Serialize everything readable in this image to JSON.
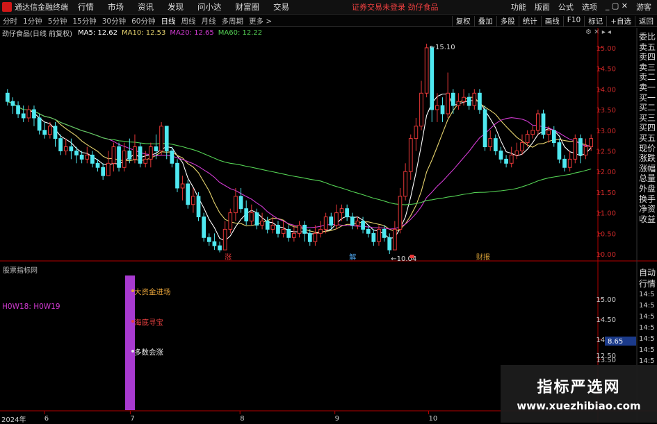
{
  "menubar": {
    "app_title": "通达信金融终端",
    "menus": [
      "行情",
      "市场",
      "资讯",
      "发现",
      "问小达",
      "财富圈",
      "交易"
    ],
    "alert": "证券交易未登录 劲仔食品",
    "right_items": [
      "功能",
      "版面",
      "公式",
      "选项"
    ],
    "window_controls": "_ ▢ ✕",
    "guest": "游客"
  },
  "periodbar": {
    "tabs": [
      "分时",
      "1分钟",
      "5分钟",
      "15分钟",
      "30分钟",
      "60分钟",
      "日线",
      "周线",
      "月线",
      "多周期",
      "更多 >"
    ],
    "active": "日线",
    "right_buttons": [
      "复权",
      "叠加",
      "多股",
      "统计",
      "画线",
      "F10",
      "标记",
      "+自选",
      "返回"
    ]
  },
  "chart_header": {
    "stock": "劲仔食品(日线 前复权)",
    "ma5": "MA5: 12.62",
    "ma10": "MA10: 12.53",
    "ma20": "MA20: 12.65",
    "ma60": "MA60: 12.22",
    "icons": "⚙ ✕ ▸ ◂"
  },
  "right_panel": [
    "委比",
    "卖五",
    "卖四",
    "卖三",
    "卖二",
    "卖一",
    "买一",
    "买二",
    "买三",
    "买四",
    "买五",
    "现价",
    "涨跌",
    "涨幅",
    "总量",
    "外盘",
    "换手",
    "净资",
    "收益"
  ],
  "right_panel_bottom": [
    "自动",
    "行情",
    "14:5",
    "14:5",
    "14:5",
    "14:5",
    "14:5",
    "14:5",
    "14:5"
  ],
  "colors": {
    "up": "#e83838",
    "down": "#4fe8f0",
    "ma5": "#ffffff",
    "ma10": "#e6d36e",
    "ma20": "#d03ad0",
    "ma60": "#54d254",
    "axis": "#b40000",
    "grid": "#3a0000"
  },
  "chart_data": {
    "type": "candlestick",
    "title": "劲仔食品(日线 前复权)",
    "xlabel": "",
    "ylabel": "",
    "ylim": [
      9.9,
      15.2
    ],
    "yticks": [
      "15.00",
      "14.50",
      "14.00",
      "13.50",
      "13.00",
      "12.50",
      "12.00",
      "11.50",
      "11.00",
      "10.50",
      "10.00"
    ],
    "x_month_labels": [
      "2024年",
      "6",
      "7",
      "8",
      "9",
      "10"
    ],
    "annotations": {
      "high": "15.10",
      "low": "10.04"
    },
    "event_markers": [
      "涨",
      "解",
      "",
      "财报"
    ],
    "moving_averages": {
      "MA5": 12.62,
      "MA10": 12.53,
      "MA20": 12.65,
      "MA60": 12.22
    },
    "candles": [
      [
        13.9,
        13.7,
        14.0,
        13.6
      ],
      [
        13.7,
        13.6,
        13.8,
        13.4
      ],
      [
        13.6,
        13.4,
        13.7,
        13.3
      ],
      [
        13.4,
        13.3,
        13.6,
        13.2
      ],
      [
        13.3,
        13.5,
        13.6,
        13.2
      ],
      [
        13.5,
        13.3,
        13.6,
        13.1
      ],
      [
        13.3,
        13.0,
        13.4,
        12.9
      ],
      [
        13.0,
        12.9,
        13.2,
        12.8
      ],
      [
        12.9,
        13.1,
        13.2,
        12.8
      ],
      [
        13.1,
        12.8,
        13.2,
        12.6
      ],
      [
        12.8,
        12.5,
        12.9,
        12.4
      ],
      [
        12.5,
        12.6,
        12.8,
        12.4
      ],
      [
        12.6,
        12.5,
        12.8,
        12.3
      ],
      [
        12.5,
        12.4,
        12.6,
        12.2
      ],
      [
        12.4,
        12.3,
        12.5,
        12.2
      ],
      [
        12.3,
        12.4,
        12.6,
        12.2
      ],
      [
        12.4,
        12.2,
        12.5,
        12.1
      ],
      [
        12.2,
        12.1,
        12.3,
        12.0
      ],
      [
        12.1,
        11.9,
        12.2,
        11.8
      ],
      [
        11.9,
        12.2,
        12.5,
        11.9
      ],
      [
        12.2,
        12.6,
        12.7,
        12.0
      ],
      [
        12.6,
        12.1,
        12.7,
        12.0
      ],
      [
        12.1,
        12.5,
        12.7,
        12.0
      ],
      [
        12.5,
        12.3,
        12.8,
        12.2
      ],
      [
        12.3,
        12.6,
        12.9,
        12.2
      ],
      [
        12.6,
        12.2,
        12.7,
        12.1
      ],
      [
        12.2,
        12.3,
        12.5,
        12.1
      ],
      [
        12.3,
        12.6,
        12.7,
        12.1
      ],
      [
        12.6,
        12.5,
        12.9,
        12.3
      ],
      [
        12.5,
        13.1,
        13.2,
        12.4
      ],
      [
        13.1,
        12.5,
        13.1,
        12.3
      ],
      [
        12.5,
        12.2,
        12.6,
        12.1
      ],
      [
        12.2,
        11.6,
        12.3,
        11.5
      ],
      [
        11.6,
        11.7,
        11.9,
        11.3
      ],
      [
        11.7,
        11.2,
        11.8,
        11.1
      ],
      [
        11.2,
        11.4,
        11.6,
        11.0
      ],
      [
        11.4,
        10.9,
        11.5,
        10.8
      ],
      [
        10.9,
        10.4,
        11.0,
        10.3
      ],
      [
        10.4,
        10.3,
        10.5,
        10.2
      ],
      [
        10.3,
        10.2,
        10.5,
        10.1
      ],
      [
        10.2,
        10.1,
        10.3,
        10.04
      ],
      [
        10.1,
        10.6,
        10.8,
        10.1
      ],
      [
        10.6,
        11.0,
        11.1,
        10.5
      ],
      [
        11.0,
        11.4,
        11.6,
        10.8
      ],
      [
        11.4,
        11.1,
        11.6,
        11.0
      ],
      [
        11.1,
        10.8,
        11.3,
        10.7
      ],
      [
        10.8,
        11.0,
        11.2,
        10.7
      ],
      [
        11.0,
        10.7,
        11.1,
        10.6
      ],
      [
        10.7,
        10.8,
        11.0,
        10.6
      ],
      [
        10.8,
        10.6,
        10.9,
        10.5
      ],
      [
        10.6,
        10.7,
        10.9,
        10.5
      ],
      [
        10.7,
        10.5,
        10.8,
        10.4
      ],
      [
        10.5,
        10.6,
        10.8,
        10.4
      ],
      [
        10.6,
        10.4,
        10.7,
        10.3
      ],
      [
        10.4,
        10.5,
        10.7,
        10.3
      ],
      [
        10.5,
        10.7,
        10.8,
        10.4
      ],
      [
        10.7,
        10.5,
        10.8,
        10.3
      ],
      [
        10.5,
        10.3,
        10.6,
        10.2
      ],
      [
        10.3,
        10.5,
        10.7,
        10.2
      ],
      [
        10.5,
        10.6,
        10.8,
        10.4
      ],
      [
        10.6,
        10.9,
        11.0,
        10.5
      ],
      [
        10.9,
        10.7,
        11.0,
        10.6
      ],
      [
        10.7,
        11.0,
        11.2,
        10.6
      ],
      [
        11.0,
        11.1,
        11.2,
        10.8
      ],
      [
        11.1,
        10.9,
        11.2,
        10.8
      ],
      [
        10.9,
        10.7,
        11.0,
        10.6
      ],
      [
        10.7,
        10.8,
        10.9,
        10.6
      ],
      [
        10.8,
        10.6,
        10.9,
        10.5
      ],
      [
        10.6,
        10.5,
        10.7,
        10.4
      ],
      [
        10.5,
        10.3,
        10.6,
        10.2
      ],
      [
        10.3,
        10.6,
        10.7,
        10.2
      ],
      [
        10.6,
        10.4,
        10.7,
        10.3
      ],
      [
        10.4,
        10.1,
        10.5,
        10.0
      ],
      [
        10.1,
        10.6,
        10.8,
        10.1
      ],
      [
        10.6,
        11.4,
        11.6,
        10.5
      ],
      [
        11.4,
        12.0,
        12.2,
        11.3
      ],
      [
        12.0,
        12.8,
        12.9,
        11.8
      ],
      [
        12.8,
        13.1,
        13.3,
        12.5
      ],
      [
        13.1,
        13.9,
        14.2,
        13.0
      ],
      [
        13.9,
        15.0,
        15.1,
        13.8
      ],
      [
        15.0,
        13.5,
        15.05,
        13.2
      ],
      [
        13.5,
        13.6,
        13.9,
        13.2
      ],
      [
        13.6,
        13.4,
        13.8,
        13.2
      ],
      [
        13.4,
        13.9,
        14.4,
        13.3
      ],
      [
        13.9,
        13.6,
        14.0,
        13.4
      ],
      [
        13.6,
        13.7,
        13.9,
        13.5
      ],
      [
        13.7,
        13.8,
        14.0,
        13.6
      ],
      [
        13.8,
        13.6,
        13.9,
        13.5
      ],
      [
        13.6,
        13.9,
        14.0,
        13.5
      ],
      [
        13.9,
        13.5,
        14.0,
        13.4
      ],
      [
        13.5,
        12.6,
        13.6,
        12.5
      ],
      [
        12.6,
        12.8,
        13.0,
        12.5
      ],
      [
        12.8,
        12.5,
        12.9,
        12.4
      ],
      [
        12.5,
        12.3,
        12.6,
        12.2
      ],
      [
        12.3,
        12.2,
        12.4,
        12.1
      ],
      [
        12.2,
        12.4,
        12.6,
        12.1
      ],
      [
        12.4,
        12.5,
        12.7,
        12.3
      ],
      [
        12.5,
        12.7,
        12.9,
        12.4
      ],
      [
        12.7,
        12.9,
        13.0,
        12.6
      ],
      [
        12.9,
        13.0,
        13.1,
        12.8
      ],
      [
        13.0,
        13.4,
        13.5,
        12.9
      ],
      [
        13.4,
        12.9,
        13.5,
        12.8
      ],
      [
        12.9,
        13.0,
        13.1,
        12.7
      ],
      [
        13.0,
        12.7,
        13.1,
        12.6
      ],
      [
        12.7,
        12.3,
        12.8,
        12.2
      ],
      [
        12.3,
        12.1,
        12.4,
        12.0
      ],
      [
        12.1,
        12.3,
        12.5,
        12.0
      ],
      [
        12.3,
        12.8,
        12.9,
        12.2
      ],
      [
        12.8,
        12.4,
        12.9,
        12.2
      ],
      [
        12.4,
        12.6,
        12.8,
        12.3
      ],
      [
        12.6,
        12.8,
        12.9,
        12.5
      ]
    ]
  },
  "indicator": {
    "title": "股票指标网",
    "lines": "H0W18: H0W19",
    "signals": [
      "大资金进场",
      "海底寻宝",
      "多数会涨"
    ],
    "yticks": [
      "15.00",
      "14.50",
      "14.00",
      "13.50",
      "13.00"
    ],
    "cur_label": "8.65",
    "low_tick": "12.50",
    "x_label": "2024年"
  },
  "watermark": {
    "line1": "指标严选网",
    "line2": "www.xuezhibiao.com"
  }
}
